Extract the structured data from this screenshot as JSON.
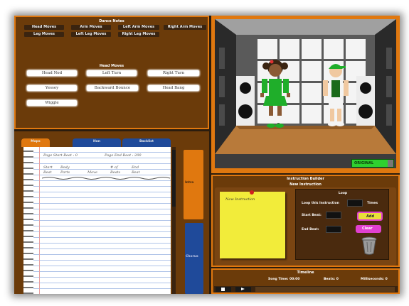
{
  "dance_notes": {
    "title": "Dance Notes",
    "categories": [
      "Head Moves",
      "Arm Moves",
      "Left Arm Moves",
      "Right Arm Moves",
      "Leg Moves",
      "Left Leg Moves",
      "Right Leg Moves"
    ],
    "head_moves_title": "Head Moves",
    "moves": [
      "Head Nod",
      "Left Turn",
      "Right Turn",
      "Yessey",
      "Backward Bounce",
      "Head Bang",
      "Wiggle"
    ]
  },
  "notebook": {
    "tabs": [
      "Maps",
      "Hon",
      "Backlist"
    ],
    "page_start_beat": "Page Start Beat : 0",
    "page_end_beat": "Page End Beat : 200",
    "col1": [
      "Start",
      "Beat"
    ],
    "col2": [
      "Body",
      "Parts"
    ],
    "col3": [
      "Move"
    ],
    "col4": [
      "# of",
      "Beats"
    ],
    "col5": [
      "End",
      "Beat"
    ],
    "side_tabs": [
      "Intro",
      "Chorus"
    ]
  },
  "stage": {
    "option_value": "ORIGINAL"
  },
  "instruction_builder": {
    "title": "Instruction Builder",
    "new_instruction": "New Instruction",
    "sticky_text": "New Instruction",
    "loop_title": "Loop",
    "loop_label": "Loop this Instruction",
    "times_label": "Times",
    "start_beat_label": "Start Beat:",
    "end_beat_label": "End Beat:",
    "add_label": "Add",
    "clear_label": "Clear"
  },
  "timeline": {
    "title": "Timeline",
    "song_time": "Song Time: 00:00",
    "beats": "Beats: 0",
    "milliseconds": "Milliseconds: 0"
  },
  "colors": {
    "accent_orange": "#e0780f",
    "panel_brown": "#6b3b0a",
    "tab_blue": "#1f4a9a",
    "sticky_yellow": "#f2ec3a",
    "add_yellow": "#e8e03a",
    "clear_pink": "#e040d0"
  }
}
